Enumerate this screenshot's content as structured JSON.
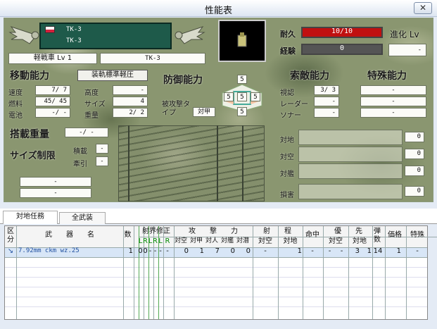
{
  "window": {
    "title": "性能表",
    "close_glyph": "✕"
  },
  "unit": {
    "line1": "TK-3",
    "line2": "TK-3",
    "type_level": "軽戦車 Lv 1",
    "name": "TK-3"
  },
  "status": {
    "durability_label": "耐久",
    "durability_value": "10/10",
    "exp_label": "経験",
    "exp_value": "0",
    "evo_label": "進化 Lv",
    "evo_value": "-"
  },
  "mobility": {
    "heading": "移動能力",
    "armor_button": "装軌標準軽圧",
    "speed_label": "速度",
    "speed_value": "7/ 7",
    "fuel_label": "燃料",
    "fuel_value": "45/ 45",
    "battery_label": "電池",
    "battery_value": "-/ -",
    "altitude_label": "高度",
    "altitude_value": "-",
    "size_label": "サイズ",
    "size_value": "4",
    "weight_label": "重量",
    "weight_value": "2/ 2"
  },
  "defense": {
    "heading": "防御能力",
    "front": "5",
    "left": "5",
    "center": "5",
    "right": "5",
    "rear": "5",
    "attacked_type_label": "被攻撃タイプ",
    "attacked_type_value": "対甲"
  },
  "search": {
    "heading": "索敵能力",
    "vision_label": "視認",
    "vision_value": "3/ 3",
    "radar_label": "レーダー",
    "radar_value": "-",
    "sonar_label": "ソナー",
    "sonar_value": "-"
  },
  "special": {
    "heading": "特殊能力",
    "slots": [
      "-",
      "-",
      "-"
    ]
  },
  "cargo": {
    "load_label": "搭載重量",
    "load_value": "-/ -",
    "size_limit_label": "サイズ制限",
    "carry_label": "積載",
    "carry_value": "-",
    "tow_label": "牽引",
    "tow_value": "-",
    "extra1": "-",
    "extra2": "-"
  },
  "counts": {
    "ground_label": "対地",
    "ground_value": "0",
    "air_label": "対空",
    "air_value": "0",
    "ship_label": "対艦",
    "ship_value": "0",
    "damage_label": "損害",
    "damage_value": "0"
  },
  "tabs": [
    "対地任務",
    "全武装"
  ],
  "table": {
    "headers": {
      "div": "区分",
      "weapon": "武　　器　　名",
      "count": "数",
      "boundary": "射界修正",
      "attack": "攻　　撃　　力",
      "range": "射　　程",
      "hit": "命中",
      "priority": "優　　先",
      "ammo": "弾数",
      "price": "価格",
      "special": "特殊"
    },
    "sub_lr": [
      "L",
      "R",
      "L",
      "R",
      "L",
      "R"
    ],
    "sub_attack": [
      "対空",
      "対甲",
      "対人",
      "対艦",
      "対潜"
    ],
    "sub_range": [
      "対空",
      "対地"
    ],
    "sub_priority": [
      "対空",
      "対地"
    ],
    "rows": [
      {
        "weapon": "7.92mm ckm wz.25",
        "count": "1",
        "lr": [
          "0",
          "0",
          "-",
          "-",
          "-",
          "-"
        ],
        "attack": [
          "0",
          "1",
          "7",
          "0",
          "0"
        ],
        "range_air": "-",
        "range_ground": "1",
        "hit": "-",
        "prio": [
          "-",
          "-",
          "3",
          "1"
        ],
        "ammo": "14",
        "price": "1",
        "special": "-"
      }
    ]
  },
  "colors": {
    "durability_bar": "#c01010",
    "exp_bar": "#555555",
    "unit_panel": "#1e5a4a"
  }
}
